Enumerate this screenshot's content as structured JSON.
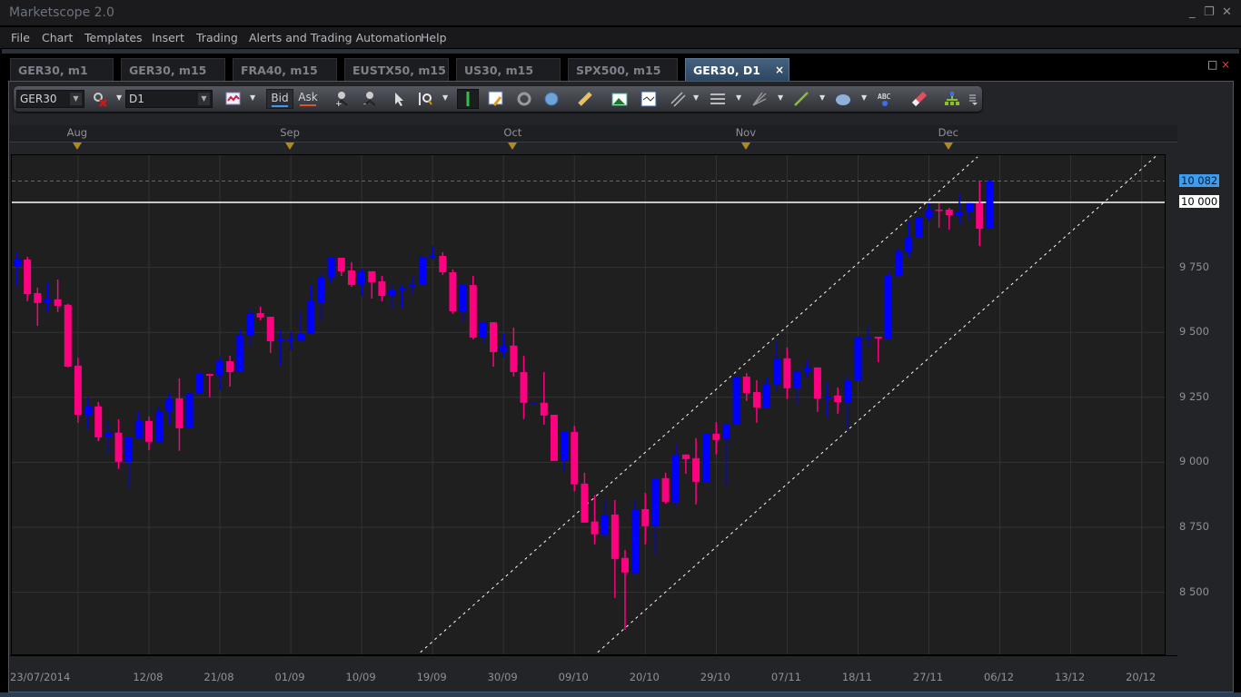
{
  "app": {
    "title": "Marketscope 2.0"
  },
  "window_controls": {
    "minimize": "_",
    "restore": "❐",
    "close": "✕"
  },
  "menu": [
    "File",
    "Chart",
    "Templates",
    "Insert",
    "Trading",
    "Alerts and Trading Automation",
    "Help"
  ],
  "tabs": [
    {
      "label": "GER30, m1"
    },
    {
      "label": "GER30, m15"
    },
    {
      "label": "FRA40, m15"
    },
    {
      "label": "EUSTX50, m15"
    },
    {
      "label": "US30, m15"
    },
    {
      "label": "SPX500, m15"
    },
    {
      "label": "GER30, D1",
      "active": true
    }
  ],
  "tab_close": "×",
  "chart_window_controls": {
    "maximize": "□",
    "close": "×"
  },
  "toolbar": {
    "instrument": "GER30",
    "timeframe": "D1",
    "bid": "Bid",
    "ask": "Ask",
    "bid_color": "#3d9cf0",
    "ask_color": "#e2502e",
    "icons": [
      "chart-type-icon",
      "unlink-icon",
      "add-indicator-icon",
      "remove-indicator-icon",
      "cursor-icon",
      "zoom-icon",
      "crosshair-icon",
      "properties-icon",
      "view-icon",
      "globe-icon",
      "ruler-icon",
      "add-chart-icon",
      "chart-window-icon",
      "channel-icon",
      "levels-icon",
      "fan-icon",
      "line-icon",
      "shape-icon",
      "text-icon",
      "eraser-icon",
      "hierarchy-icon",
      "more-icon"
    ]
  },
  "chart_data": {
    "type": "candlestick",
    "symbol": "GER30",
    "timeframe": "D1",
    "up_color": "#0000ff",
    "down_color": "#ff0080",
    "ylim": [
      8269,
      10190
    ],
    "yticks": [
      {
        "value": 9750,
        "label": "9 750"
      },
      {
        "value": 9500,
        "label": "9 500"
      },
      {
        "value": 9250,
        "label": "9 250"
      },
      {
        "value": 9000,
        "label": "9 000"
      },
      {
        "value": 8750,
        "label": "8 750"
      },
      {
        "value": 8500,
        "label": "8 500"
      }
    ],
    "current_price": {
      "value": 10082,
      "label": "10 082"
    },
    "level_line": {
      "value": 10000,
      "label": "10 000"
    },
    "months": [
      {
        "label": "Aug",
        "index": 6
      },
      {
        "label": "Sep",
        "index": 27
      },
      {
        "label": "Oct",
        "index": 49
      },
      {
        "label": "Nov",
        "index": 72
      },
      {
        "label": "Dec",
        "index": 92
      }
    ],
    "xticks": [
      {
        "label": "23/07/2014",
        "index": 0
      },
      {
        "label": "12/08",
        "index": 13
      },
      {
        "label": "21/08",
        "index": 20
      },
      {
        "label": "01/09",
        "index": 27
      },
      {
        "label": "10/09",
        "index": 34
      },
      {
        "label": "19/09",
        "index": 41
      },
      {
        "label": "30/09",
        "index": 48
      },
      {
        "label": "09/10",
        "index": 55
      },
      {
        "label": "20/10",
        "index": 62
      },
      {
        "label": "29/10",
        "index": 69
      },
      {
        "label": "07/11",
        "index": 76
      },
      {
        "label": "18/11",
        "index": 83
      },
      {
        "label": "27/11",
        "index": 90
      },
      {
        "label": "06/12",
        "index": 97
      },
      {
        "label": "13/12",
        "index": 104
      },
      {
        "label": "20/12",
        "index": 111
      }
    ],
    "trendlines": [
      {
        "from": [
          39.8,
          8269
        ],
        "to": [
          94.8,
          10175
        ]
      },
      {
        "from": [
          57.3,
          8269
        ],
        "to": [
          112.5,
          10181
        ]
      }
    ],
    "ohlc": [
      [
        9752,
        9808,
        9675,
        9780
      ],
      [
        9780,
        9791,
        9620,
        9647
      ],
      [
        9651,
        9672,
        9525,
        9613
      ],
      [
        9613,
        9689,
        9578,
        9627
      ],
      [
        9627,
        9703,
        9578,
        9602
      ],
      [
        9606,
        9610,
        9365,
        9368
      ],
      [
        9372,
        9403,
        9152,
        9183
      ],
      [
        9183,
        9253,
        9128,
        9215
      ],
      [
        9215,
        9232,
        9082,
        9096
      ],
      [
        9096,
        9162,
        9033,
        9114
      ],
      [
        9114,
        9166,
        8974,
        9002
      ],
      [
        9002,
        9096,
        8904,
        9096
      ],
      [
        9093,
        9197,
        9093,
        9159
      ],
      [
        9159,
        9176,
        9047,
        9079
      ],
      [
        9079,
        9215,
        9079,
        9197
      ],
      [
        9194,
        9264,
        9145,
        9246
      ],
      [
        9246,
        9323,
        9044,
        9131
      ],
      [
        9131,
        9267,
        9131,
        9267
      ],
      [
        9264,
        9351,
        9264,
        9340
      ],
      [
        9340,
        9340,
        9250,
        9333
      ],
      [
        9333,
        9407,
        9278,
        9389
      ],
      [
        9389,
        9410,
        9291,
        9347
      ],
      [
        9347,
        9511,
        9347,
        9487
      ],
      [
        9487,
        9592,
        9445,
        9574
      ],
      [
        9574,
        9599,
        9546,
        9557
      ],
      [
        9560,
        9560,
        9421,
        9466
      ],
      [
        9470,
        9511,
        9372,
        9473
      ],
      [
        9470,
        9504,
        9431,
        9473
      ],
      [
        9470,
        9578,
        9470,
        9497
      ],
      [
        9494,
        9682,
        9494,
        9620
      ],
      [
        9616,
        9735,
        9543,
        9710
      ],
      [
        9710,
        9787,
        9692,
        9787
      ],
      [
        9787,
        9787,
        9717,
        9735
      ],
      [
        9738,
        9770,
        9675,
        9682
      ],
      [
        9682,
        9745,
        9640,
        9735
      ],
      [
        9735,
        9735,
        9630,
        9693
      ],
      [
        9696,
        9717,
        9620,
        9640
      ],
      [
        9640,
        9682,
        9595,
        9665
      ],
      [
        9661,
        9682,
        9592,
        9672
      ],
      [
        9675,
        9717,
        9651,
        9682
      ],
      [
        9682,
        9791,
        9682,
        9791
      ],
      [
        9787,
        9833,
        9780,
        9794
      ],
      [
        9794,
        9808,
        9721,
        9731
      ],
      [
        9731,
        9742,
        9571,
        9581
      ],
      [
        9581,
        9682,
        9536,
        9682
      ],
      [
        9682,
        9717,
        9473,
        9480
      ],
      [
        9480,
        9546,
        9459,
        9539
      ],
      [
        9539,
        9539,
        9368,
        9424
      ],
      [
        9424,
        9494,
        9403,
        9449
      ],
      [
        9449,
        9518,
        9330,
        9347
      ],
      [
        9347,
        9410,
        9166,
        9229
      ],
      [
        9229,
        9232,
        9229,
        9232
      ],
      [
        9229,
        9347,
        9145,
        9180
      ],
      [
        9183,
        9183,
        9005,
        9005
      ],
      [
        9005,
        9120,
        8963,
        9117
      ],
      [
        9117,
        9141,
        8890,
        8915
      ],
      [
        8918,
        8960,
        8768,
        8768
      ],
      [
        8772,
        8873,
        8684,
        8723
      ],
      [
        8723,
        8855,
        8705,
        8799
      ],
      [
        8799,
        8855,
        8478,
        8628
      ],
      [
        8632,
        8663,
        8356,
        8576
      ],
      [
        8576,
        8855,
        8566,
        8820
      ],
      [
        8820,
        8883,
        8684,
        8754
      ],
      [
        8754,
        8939,
        8642,
        8939
      ],
      [
        8939,
        8960,
        8841,
        8848
      ],
      [
        8848,
        9072,
        8824,
        9030
      ],
      [
        9030,
        9030,
        8956,
        9012
      ],
      [
        9016,
        9093,
        8838,
        8925
      ],
      [
        8925,
        9110,
        8925,
        9110
      ],
      [
        9110,
        9155,
        9030,
        9086
      ],
      [
        9089,
        9155,
        8908,
        9148
      ],
      [
        9145,
        9330,
        9145,
        9330
      ],
      [
        9330,
        9344,
        9236,
        9267
      ],
      [
        9270,
        9316,
        9152,
        9211
      ],
      [
        9211,
        9330,
        9211,
        9302
      ],
      [
        9298,
        9466,
        9274,
        9400
      ],
      [
        9400,
        9442,
        9243,
        9285
      ],
      [
        9285,
        9351,
        9222,
        9351
      ],
      [
        9347,
        9393,
        9326,
        9365
      ],
      [
        9365,
        9365,
        9194,
        9246
      ],
      [
        9246,
        9309,
        9176,
        9253
      ],
      [
        9257,
        9288,
        9187,
        9232
      ],
      [
        9232,
        9333,
        9134,
        9316
      ],
      [
        9316,
        9483,
        9316,
        9483
      ],
      [
        9480,
        9522,
        9442,
        9483
      ],
      [
        9483,
        9483,
        9386,
        9476
      ],
      [
        9476,
        9735,
        9476,
        9717
      ],
      [
        9717,
        9825,
        9710,
        9812
      ],
      [
        9808,
        9927,
        9787,
        9867
      ],
      [
        9864,
        9944,
        9864,
        9944
      ],
      [
        9941,
        9997,
        9927,
        9972
      ],
      [
        9972,
        9997,
        9902,
        9969
      ],
      [
        9972,
        9979,
        9895,
        9951
      ],
      [
        9951,
        10035,
        9913,
        9965
      ],
      [
        9962,
        9997,
        9930,
        9997
      ],
      [
        9997,
        10084,
        9832,
        9899
      ],
      [
        9899,
        10090,
        9899,
        10082
      ]
    ]
  }
}
